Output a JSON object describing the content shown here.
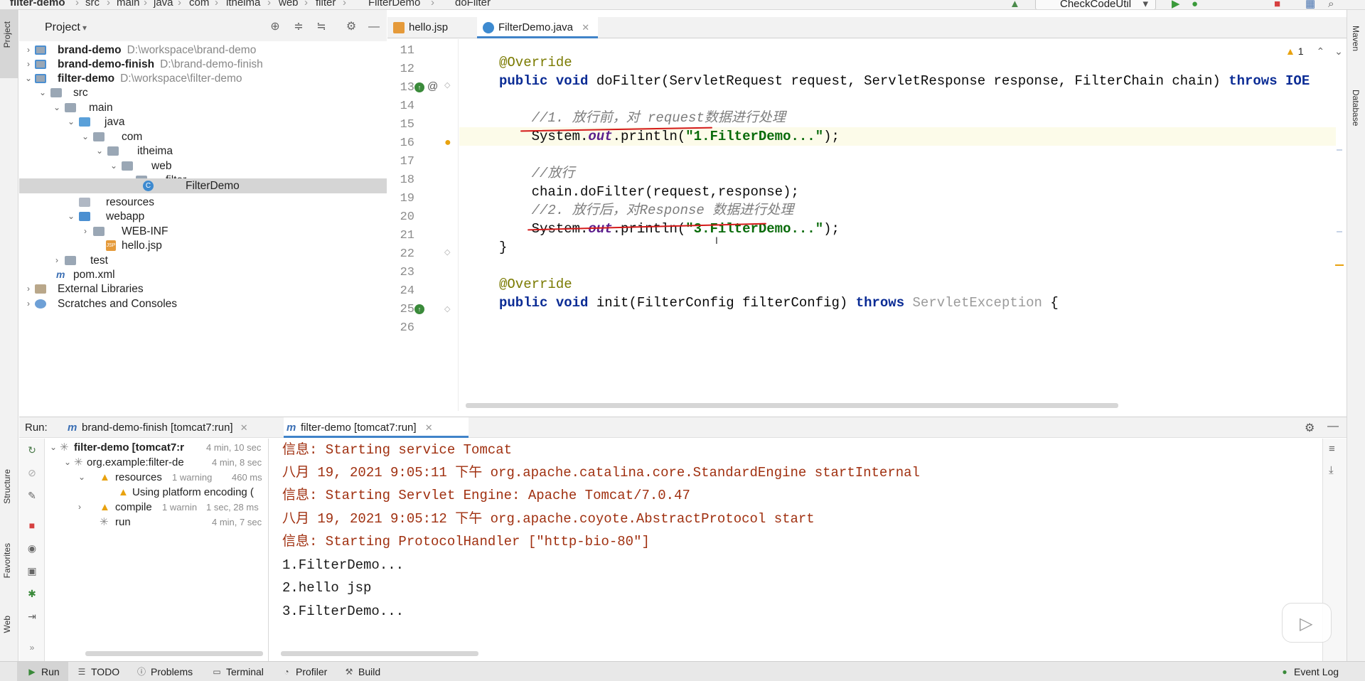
{
  "navbar": {
    "breadcrumbs": [
      "filter-demo",
      "src",
      "main",
      "java",
      "com",
      "itheima",
      "web",
      "filter",
      "FilterDemo",
      "doFilter"
    ],
    "run_config": "CheckCodeUtil"
  },
  "left_strip": {
    "project": "Project",
    "structure": "Structure",
    "favorites": "Favorites",
    "web": "Web"
  },
  "right_strip": {
    "maven": "Maven",
    "database": "Database"
  },
  "project_panel": {
    "title": "Project",
    "tree": [
      {
        "label": "brand-demo",
        "path": "D:\\workspace\\brand-demo"
      },
      {
        "label": "brand-demo-finish",
        "path": "D:\\brand-demo-finish"
      },
      {
        "label": "filter-demo",
        "path": "D:\\workspace\\filter-demo"
      },
      {
        "label": "src"
      },
      {
        "label": "main"
      },
      {
        "label": "java"
      },
      {
        "label": "com"
      },
      {
        "label": "itheima"
      },
      {
        "label": "web"
      },
      {
        "label": "filter"
      },
      {
        "label": "FilterDemo"
      },
      {
        "label": "resources"
      },
      {
        "label": "webapp"
      },
      {
        "label": "WEB-INF"
      },
      {
        "label": "hello.jsp"
      },
      {
        "label": "test"
      },
      {
        "label": "pom.xml"
      },
      {
        "label": "External Libraries"
      },
      {
        "label": "Scratches and Consoles"
      }
    ]
  },
  "editor": {
    "tabs": [
      {
        "label": "hello.jsp"
      },
      {
        "label": "FilterDemo.java"
      }
    ],
    "warning_count": "1",
    "line_numbers": [
      "11",
      "12",
      "13",
      "14",
      "15",
      "16",
      "17",
      "18",
      "19",
      "20",
      "21",
      "22",
      "23",
      "24",
      "25",
      "26"
    ],
    "code": {
      "l12": "@Override",
      "l13_kw1": "public",
      "l13_kw2": "void",
      "l13_text": " doFilter(ServletRequest request, ServletResponse response, FilterChain chain) ",
      "l13_kw3": "throws",
      "l13_tail": " IOE",
      "l15": "    //1. 放行前，对 request数据进行处理",
      "l16_a": "    System.",
      "l16_b": "out",
      "l16_c": ".println(",
      "l16_str": "\"1.FilterDemo...\"",
      "l16_d": ");",
      "l18": "    //放行",
      "l19": "    chain.doFilter(request,response);",
      "l20": "    //2. 放行后，对Response 数据进行处理",
      "l21_a": "    System.",
      "l21_b": "out",
      "l21_c": ".println(",
      "l21_str": "\"3.FilterDemo...\"",
      "l21_d": ");",
      "l22": "}",
      "l24": "@Override",
      "l25_kw1": "public",
      "l25_kw2": "void",
      "l25_text": " init(FilterConfig filterConfig) ",
      "l25_kw3": "throws",
      "l25_gray": " ServletException",
      "l25_tail": " {"
    }
  },
  "run_panel": {
    "label": "Run:",
    "tabs": [
      {
        "label": "brand-demo-finish [tomcat7:run]"
      },
      {
        "label": "filter-demo [tomcat7:run]"
      }
    ],
    "tree": [
      {
        "label": "filter-demo [tomcat7:r",
        "time": "4 min, 10 sec"
      },
      {
        "label": "org.example:filter-de",
        "time": "4 min, 8 sec"
      },
      {
        "label": "resources",
        "note": "1 warning",
        "time": "460 ms"
      },
      {
        "label": "Using platform encoding ("
      },
      {
        "label": "compile",
        "note": "1 warnin",
        "time": "1 sec, 28 ms"
      },
      {
        "label": "run",
        "time": "4 min, 7 sec"
      }
    ],
    "console": [
      "信息: Starting service Tomcat",
      "八月 19, 2021 9:05:11 下午 org.apache.catalina.core.StandardEngine startInternal",
      "信息: Starting Servlet Engine: Apache Tomcat/7.0.47",
      "八月 19, 2021 9:05:12 下午 org.apache.coyote.AbstractProtocol start",
      "信息: Starting ProtocolHandler [\"http-bio-80\"]",
      "1.FilterDemo...",
      "2.hello jsp",
      "3.FilterDemo..."
    ]
  },
  "bottom_bar": {
    "tabs": [
      "Run",
      "TODO",
      "Problems",
      "Terminal",
      "Profiler",
      "Build"
    ],
    "event_log": "Event Log"
  },
  "colors": {
    "accent": "#4083c9",
    "keyword": "#0b2c95",
    "string": "#096b0a",
    "annotation_mark": "#d41a1a"
  }
}
